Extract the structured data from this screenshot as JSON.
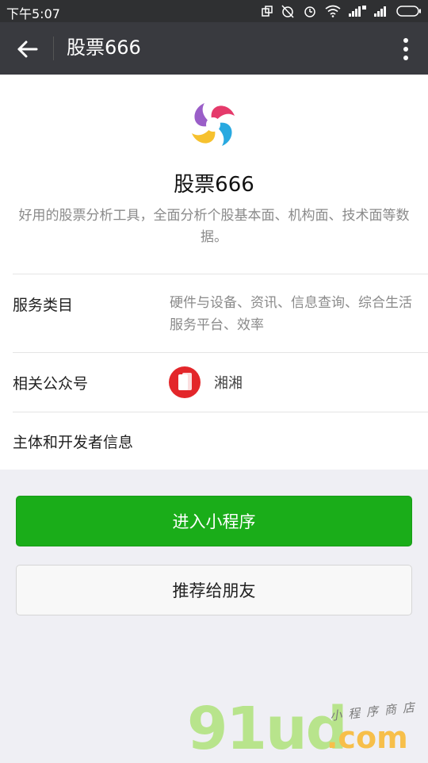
{
  "status_bar": {
    "time": "下午5:07"
  },
  "nav": {
    "title": "股票666",
    "back_icon": "arrow-left-icon",
    "more_icon": "more-vertical-icon"
  },
  "app": {
    "name": "股票666",
    "description": "好用的股票分析工具，全面分析个股基本面、机构面、技术面等数据。"
  },
  "rows": {
    "service_category": {
      "label": "服务类目",
      "value": "硬件与设备、资讯、信息查询、综合生活服务平台、效率"
    },
    "related_account": {
      "label": "相关公众号",
      "value": "湘湘"
    },
    "developer_info": {
      "label": "主体和开发者信息"
    }
  },
  "buttons": {
    "enter": "进入小程序",
    "recommend": "推荐给朋友"
  },
  "watermark": {
    "main": "91ud",
    "dotcom": ".com",
    "small": "小程序商店"
  },
  "colors": {
    "status_bar": "#2f3032",
    "nav_bar": "#393a3f",
    "primary_green": "#1aad19",
    "background": "#efeff4"
  }
}
